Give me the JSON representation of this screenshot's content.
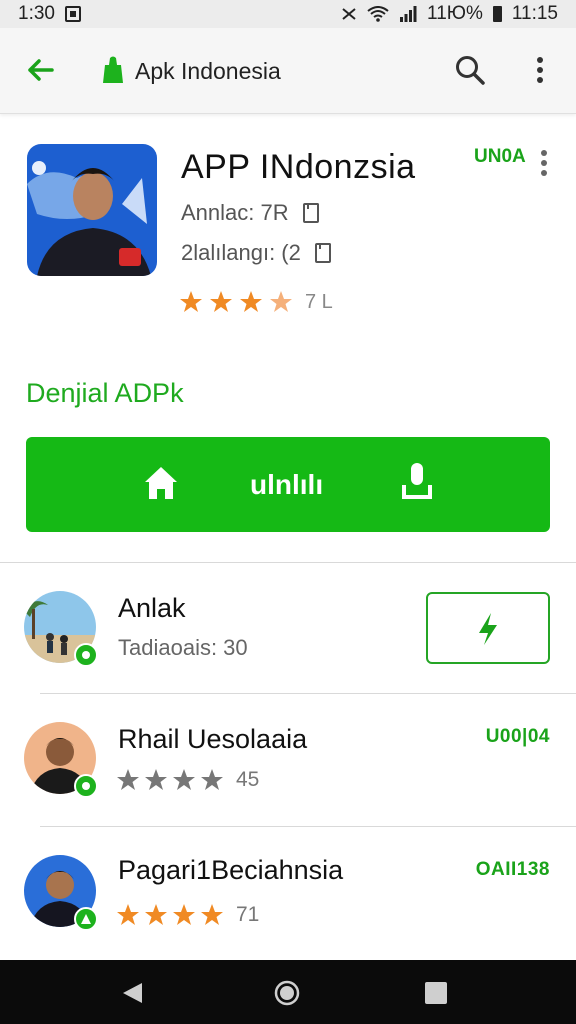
{
  "status_bar": {
    "time": "1:30",
    "battery_text": "11Ю%",
    "clock_right": "11:15"
  },
  "app_bar": {
    "title": "Apk Indonesia"
  },
  "app": {
    "name": "APP INdonzsia",
    "meta1": "Annlac: 7R",
    "meta2": "2lalılangı: (2",
    "rating_text": "7 L",
    "version_badge": "UN0A"
  },
  "download": {
    "section_title": "Denjial ADPk",
    "button_label": "ulnlılı"
  },
  "list": [
    {
      "name": "Anlak",
      "subtitle": "Tadiaoais: 30"
    },
    {
      "name": "Rhail Uesolaaia",
      "stars_count": "45",
      "code": "U00|04"
    },
    {
      "name": "Pagari1Beciahnsia",
      "stars_count": "71",
      "code": "OAII138"
    }
  ],
  "colors": {
    "accent": "#15b915",
    "star": "#f08a24",
    "star_gray": "#777777"
  }
}
